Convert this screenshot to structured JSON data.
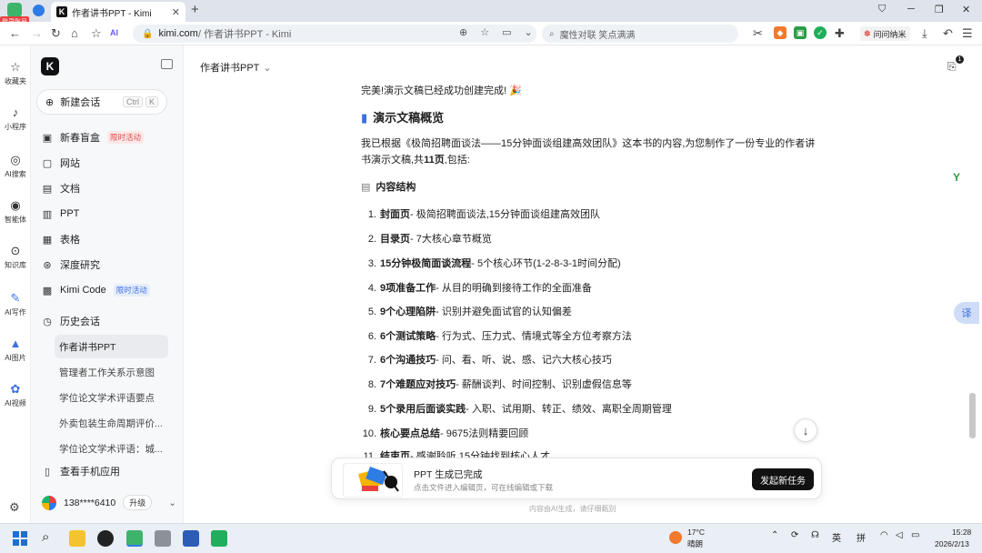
{
  "browser": {
    "login_badge": "登录账号",
    "active_tab_title": "作者讲书PPT - Kimi",
    "tab_favicon": "K",
    "new_tab": "+",
    "url_host": "kimi.com",
    "url_path": " / 作者讲书PPT - Kimi",
    "search_placeholder": "魔性对联 笑点满满",
    "ext_label": "问问纳米"
  },
  "browser_sidebar": [
    {
      "label": "收藏夹",
      "icon": "star-icon",
      "glyph": "☆"
    },
    {
      "label": "小程序",
      "icon": "tiktok-icon",
      "glyph": "♪"
    },
    {
      "label": "AI搜索",
      "icon": "search-icon",
      "glyph": "◎"
    },
    {
      "label": "智能体",
      "icon": "agent-icon",
      "glyph": "◉"
    },
    {
      "label": "知识库",
      "icon": "knowledge-icon",
      "glyph": "⊙"
    },
    {
      "label": "AI写作",
      "icon": "pen-icon",
      "glyph": "✎"
    },
    {
      "label": "AI图片",
      "icon": "image-icon",
      "glyph": "▲"
    },
    {
      "label": "AI视频",
      "icon": "video-icon",
      "glyph": "✿"
    }
  ],
  "kimi_sidebar": {
    "logo": "K",
    "new_chat": "新建会话",
    "shortcut": [
      "Ctrl",
      "K"
    ],
    "items": [
      {
        "label": "新春盲盒",
        "badge": "限时活动",
        "icon": "gift-icon",
        "glyph": "▣"
      },
      {
        "label": "网站",
        "badge": "",
        "icon": "website-icon",
        "glyph": "▢"
      },
      {
        "label": "文档",
        "badge": "",
        "icon": "doc-icon",
        "glyph": "▤"
      },
      {
        "label": "PPT",
        "badge": "",
        "icon": "ppt-icon",
        "glyph": "▥"
      },
      {
        "label": "表格",
        "badge": "",
        "icon": "table-icon",
        "glyph": "▦"
      },
      {
        "label": "深度研究",
        "badge": "",
        "icon": "research-icon",
        "glyph": "⊛"
      },
      {
        "label": "Kimi Code",
        "badge": "限时活动",
        "icon": "code-icon",
        "glyph": "▩"
      },
      {
        "label": "历史会话",
        "badge": "",
        "icon": "history-icon",
        "glyph": "◷"
      }
    ],
    "history": [
      "作者讲书PPT",
      "管理者工作关系示意图",
      "学位论文学术评语要点",
      "外卖包装生命周期评价...",
      "学位论文学术评语：城..."
    ],
    "mobile_app": "查看手机应用",
    "user_name": "138****6410",
    "upgrade": "升级"
  },
  "main": {
    "header_title": "作者讲书PPT",
    "attachment_count": "1",
    "done_text": "完美!演示文稿已经成功创建完成! 🎉",
    "overview_title": "演示文稿概览",
    "intro_a": "我已根据《极简招聘面谈法——15分钟面谈组建高效团队》这本书的内容,为您制作了一份专业的作者讲书演示文稿,共",
    "intro_pages": "11页",
    "intro_b": ",包括:",
    "structure_title": "内容结构",
    "outline": [
      {
        "num": "1.",
        "title": "封面页",
        "desc": " - 极简招聘面谈法,15分钟面谈组建高效团队"
      },
      {
        "num": "2.",
        "title": "目录页",
        "desc": " - 7大核心章节概览"
      },
      {
        "num": "3.",
        "title": "15分钟极简面谈流程",
        "desc": " - 5个核心环节(1-2-8-3-1时间分配)"
      },
      {
        "num": "4.",
        "title": "9项准备工作",
        "desc": " - 从目的明确到接待工作的全面准备"
      },
      {
        "num": "5.",
        "title": "9个心理陷阱",
        "desc": " - 识别并避免面试官的认知偏差"
      },
      {
        "num": "6.",
        "title": "6个测试策略",
        "desc": " - 行为式、压力式、情境式等全方位考察方法"
      },
      {
        "num": "7.",
        "title": "6个沟通技巧",
        "desc": " - 问、看、听、说、感、记六大核心技巧"
      },
      {
        "num": "8.",
        "title": "7个难题应对技巧",
        "desc": " - 薪酬谈判、时间控制、识别虚假信息等"
      },
      {
        "num": "9.",
        "title": "5个录用后面谈实践",
        "desc": " - 入职、试用期、转正、绩效、离职全周期管理"
      },
      {
        "num": "10.",
        "title": "核心要点总结",
        "desc": " - 9675法则精要回顾"
      },
      {
        "num": "11.",
        "title": "结束页",
        "desc": " - 感谢聆听,15分钟找到核心人才"
      }
    ],
    "translate": "译"
  },
  "toast": {
    "title": "PPT 生成已完成",
    "subtitle": "点击文件进入编辑页，可在线编辑或下载",
    "button": "发起新任务"
  },
  "disclaimer": "内容由AI生成，请仔细甄别",
  "taskbar": {
    "weather_temp": "17°C",
    "weather_desc": "晴朗",
    "ime_lang": "英",
    "ime_mode": "拼",
    "time": "15:28",
    "date": "2026/2/13"
  },
  "colors": {
    "accent_red": "#e24a4a",
    "accent_blue": "#3b6fe0",
    "button_dark": "#111111"
  }
}
